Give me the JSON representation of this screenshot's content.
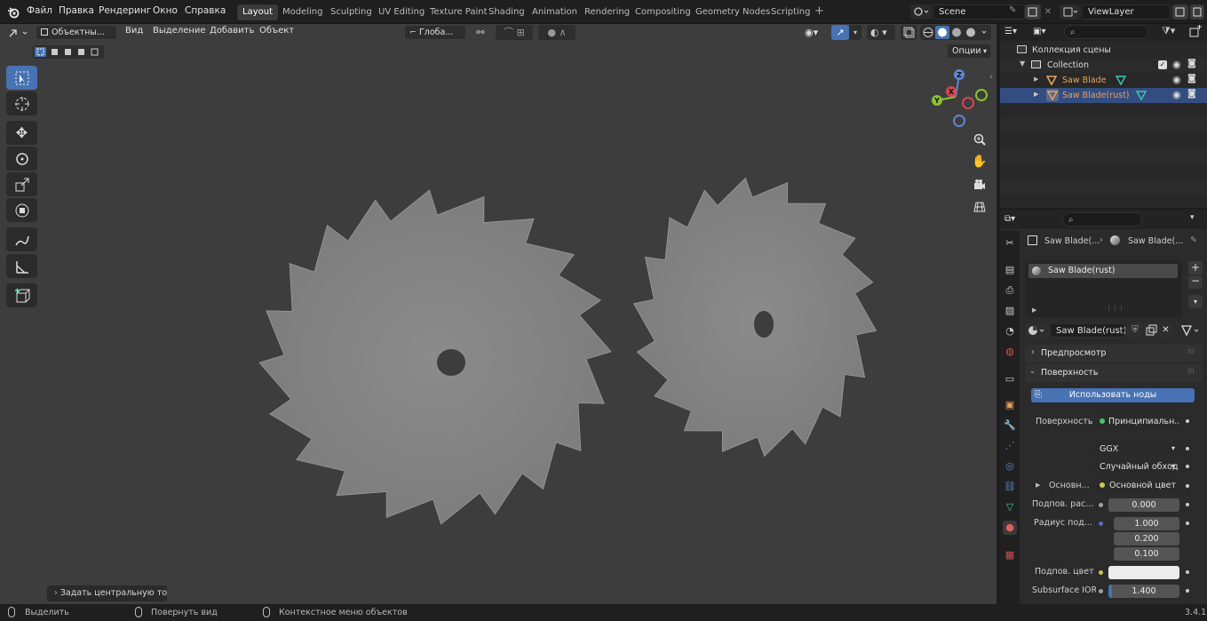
{
  "topbar": {
    "menus": [
      "Файл",
      "Правка",
      "Рендеринг",
      "Окно",
      "Справка"
    ],
    "workspaces": [
      "Layout",
      "Modeling",
      "Sculpting",
      "UV Editing",
      "Texture Paint",
      "Shading",
      "Animation",
      "Rendering",
      "Compositing",
      "Geometry Nodes",
      "Scripting"
    ],
    "active_workspace": "Layout",
    "add_workspace": "+",
    "scene": "Scene",
    "view_layer": "ViewLayer"
  },
  "viewport": {
    "mode": "Объектны...",
    "menus": [
      "Вид",
      "Выделение",
      "Добавить",
      "Объект"
    ],
    "transform_orientation": "Глоба...",
    "options_label": "Опции",
    "last_operator": "Задать центральную точк",
    "gizmo_axes": {
      "z": "Z",
      "y": "Y",
      "x": "X"
    }
  },
  "outliner": {
    "scene_collection": "Коллекция сцены",
    "collection": "Collection",
    "objects": [
      {
        "name": "Saw Blade",
        "selected": false
      },
      {
        "name": "Saw Blade(rust)",
        "selected": true
      }
    ]
  },
  "properties": {
    "breadcrumb_object": "Saw Blade(...",
    "breadcrumb_material": "Saw Blade(...",
    "slot_name": "Saw Blade(rust)",
    "material_name": "Saw Blade(rust)",
    "panel_preview": "Предпросмотр",
    "panel_surface": "Поверхность",
    "use_nodes_label": "Использовать ноды",
    "surface_label": "Поверхность",
    "surface_value": "Принципиальн...",
    "distribution": "GGX",
    "subsurface_method": "Случайный обход",
    "base_label": "Основн...",
    "base_value": "Основной цвет",
    "sub_weight_label": "Подпов. рас...",
    "sub_weight_value": "0.000",
    "sub_radius_label": "Радиус под...",
    "sub_radius_values": [
      "1.000",
      "0.200",
      "0.100"
    ],
    "sub_color_label": "Подпов. цвет",
    "sub_ior_label": "Subsurface IOR",
    "sub_ior_value": "1.400",
    "sub_ior_fill": 0.05
  },
  "statusbar": {
    "select": "Выделить",
    "rotate": "Повернуть вид",
    "context": "Контекстное меню объектов",
    "version": "3.4.1"
  },
  "colors": {
    "accent": "#4772b3",
    "selected_row": "#334d80",
    "object_orange": "#e8a060",
    "mesh_green": "#3ec9b5"
  }
}
